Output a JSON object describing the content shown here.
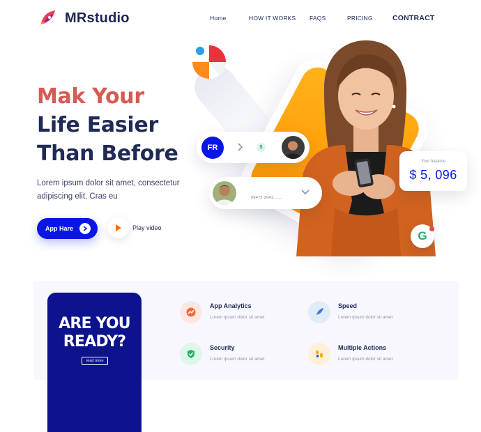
{
  "brand": {
    "name": "MRstudio"
  },
  "nav": {
    "items": [
      "Home",
      "HOW IT WORKS",
      "FAQS",
      "PRICING",
      "CONTRACT"
    ]
  },
  "hero": {
    "title_line1": "Mak Your",
    "title_line2": "Life Easier",
    "title_line3": "Than Before",
    "description": "Lorem ipsum dolor sit amet, consectetur adipiscing elit. Cras eu",
    "app_button": "App Hare",
    "play_label": "Play video"
  },
  "cards": {
    "fr_initials": "FR",
    "dollar_symbol": "$",
    "number_text": "09472 2041.......",
    "balance_label": "Your balance",
    "balance_value": "$ 5, 096",
    "g_badge": "G"
  },
  "promo": {
    "title": "ARE YOU READY?",
    "button": "read more"
  },
  "features": [
    {
      "title": "App Analytics",
      "desc": "Lorem ipsum dolor sit amet",
      "icon": "analytics-icon"
    },
    {
      "title": "Speed",
      "desc": "Lorem ipsum dolor sit amet",
      "icon": "rocket-icon"
    },
    {
      "title": "Security",
      "desc": "Lorem ipsum dolor sit amet",
      "icon": "shield-icon"
    },
    {
      "title": "Multiple Actions",
      "desc": "Lorem ipsum dolor sit amet",
      "icon": "actions-icon"
    }
  ],
  "colors": {
    "primary": "#0a16e6",
    "accent": "#d85a55",
    "navy": "#1f2a55",
    "orange": "#ff9f0a",
    "promo_bg": "#0c138c"
  }
}
